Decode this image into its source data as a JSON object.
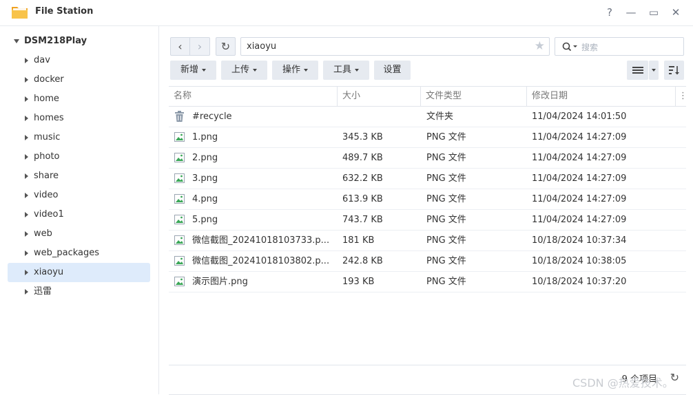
{
  "window": {
    "title": "File Station",
    "help": "?",
    "minimize": "—",
    "maximize": "▭",
    "close": "✕"
  },
  "sidebar": {
    "root": "DSM218Play",
    "items": [
      {
        "label": "dav"
      },
      {
        "label": "docker"
      },
      {
        "label": "home"
      },
      {
        "label": "homes"
      },
      {
        "label": "music"
      },
      {
        "label": "photo"
      },
      {
        "label": "share"
      },
      {
        "label": "video"
      },
      {
        "label": "video1"
      },
      {
        "label": "web"
      },
      {
        "label": "web_packages"
      },
      {
        "label": "xiaoyu",
        "selected": true
      },
      {
        "label": "迅雷"
      }
    ]
  },
  "toolbar": {
    "back": "‹",
    "forward": "›",
    "refresh": "↻",
    "path": "xiaoyu",
    "search_placeholder": "搜索",
    "buttons": {
      "create": "新增",
      "upload": "上传",
      "action": "操作",
      "tools": "工具",
      "settings": "设置"
    }
  },
  "grid": {
    "headers": {
      "name": "名称",
      "size": "大小",
      "type": "文件类型",
      "modified": "修改日期"
    },
    "rows": [
      {
        "name": "#recycle",
        "size": "",
        "type": "文件夹",
        "modified": "11/04/2024 14:01:50",
        "icon": "trash-icon"
      },
      {
        "name": "1.png",
        "size": "345.3 KB",
        "type": "PNG 文件",
        "modified": "11/04/2024 14:27:09",
        "icon": "image-file-icon"
      },
      {
        "name": "2.png",
        "size": "489.7 KB",
        "type": "PNG 文件",
        "modified": "11/04/2024 14:27:09",
        "icon": "image-file-icon"
      },
      {
        "name": "3.png",
        "size": "632.2 KB",
        "type": "PNG 文件",
        "modified": "11/04/2024 14:27:09",
        "icon": "image-file-icon"
      },
      {
        "name": "4.png",
        "size": "613.9 KB",
        "type": "PNG 文件",
        "modified": "11/04/2024 14:27:09",
        "icon": "image-file-icon"
      },
      {
        "name": "5.png",
        "size": "743.7 KB",
        "type": "PNG 文件",
        "modified": "11/04/2024 14:27:09",
        "icon": "image-file-icon"
      },
      {
        "name": "微信截图_20241018103733.p...",
        "size": "181 KB",
        "type": "PNG 文件",
        "modified": "10/18/2024 10:37:34",
        "icon": "image-file-icon"
      },
      {
        "name": "微信截图_20241018103802.p...",
        "size": "242.8 KB",
        "type": "PNG 文件",
        "modified": "10/18/2024 10:38:05",
        "icon": "image-file-icon"
      },
      {
        "name": "演示图片.png",
        "size": "193 KB",
        "type": "PNG 文件",
        "modified": "10/18/2024 10:37:20",
        "icon": "image-file-icon"
      }
    ]
  },
  "footer": {
    "count": "9 个项目",
    "refresh": "↻"
  },
  "watermark": "CSDN @热爱技术。",
  "colors": {
    "selected_bg": "#deebfb",
    "button_bg": "#e6eaf0",
    "icon_green": "#3aa757",
    "folder_orange": "#f5a623"
  }
}
